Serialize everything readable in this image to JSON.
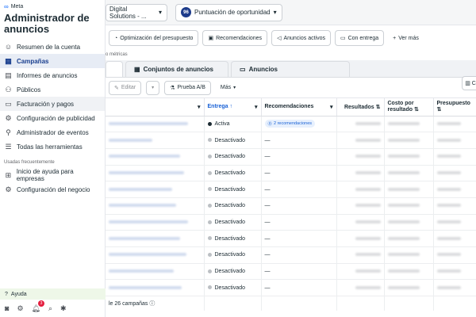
{
  "brand": {
    "logo": "∞",
    "name": "Meta"
  },
  "sidebar": {
    "title": "Administrador de anuncios",
    "items": [
      {
        "label": "Resumen de la cuenta",
        "icon": "☺"
      },
      {
        "label": "Campañas",
        "icon": "▦"
      },
      {
        "label": "Informes de anuncios",
        "icon": "▤"
      },
      {
        "label": "Públicos",
        "icon": "⚇"
      },
      {
        "label": "Facturación y pagos",
        "icon": "▭"
      },
      {
        "label": "Configuración de publicidad",
        "icon": "⚙"
      },
      {
        "label": "Administrador de eventos",
        "icon": "⚲"
      },
      {
        "label": "Todas las herramientas",
        "icon": "☰"
      }
    ],
    "section_label": "Usadas frecuentemente",
    "frequent": [
      {
        "label": "Inicio de ayuda para empresas",
        "icon": "⊞"
      },
      {
        "label": "Configuración del negocio",
        "icon": "⚙"
      }
    ],
    "help_label": "Ayuda",
    "notif_count": "3"
  },
  "topbar": {
    "account": "Digital Solutions - ...",
    "score_value": "96",
    "score_label": "Puntuación de oportunidad"
  },
  "toolbar": {
    "chips": [
      "Optimización del presupuesto",
      "Recomendaciones",
      "Anuncios activos",
      "Con entrega",
      "Ver más"
    ],
    "metrics_note": "o métricas"
  },
  "tabs": [
    "Conjuntos de anuncios",
    "Anuncios"
  ],
  "actions": {
    "edit": "Editar",
    "ab": "Prueba A/B",
    "more": "Más"
  },
  "table": {
    "headers": [
      "Entrega ↑",
      "Recomendaciones",
      "Resultados ⇅",
      "Costo por resultado ⇅",
      "Presupuesto ⇅"
    ],
    "rows": [
      {
        "status": "Activa",
        "active": true,
        "rec": "2 recomendaciones"
      },
      {
        "status": "Desactivado",
        "active": false,
        "rec": "—"
      },
      {
        "status": "Desactivado",
        "active": false,
        "rec": "—"
      },
      {
        "status": "Desactivado",
        "active": false,
        "rec": "—"
      },
      {
        "status": "Desactivado",
        "active": false,
        "rec": "—"
      },
      {
        "status": "Desactivado",
        "active": false,
        "rec": "—"
      },
      {
        "status": "Desactivado",
        "active": false,
        "rec": "—"
      },
      {
        "status": "Desactivado",
        "active": false,
        "rec": "—"
      },
      {
        "status": "Desactivado",
        "active": false,
        "rec": "—"
      },
      {
        "status": "Desactivado",
        "active": false,
        "rec": "—"
      },
      {
        "status": "Desactivado",
        "active": false,
        "rec": "—"
      }
    ],
    "footer": "le 26 campañas"
  },
  "colors": {
    "active_dot": "#1c2b33",
    "inactive_dot": "#bcc0c4",
    "accent": "#1a62d6"
  }
}
